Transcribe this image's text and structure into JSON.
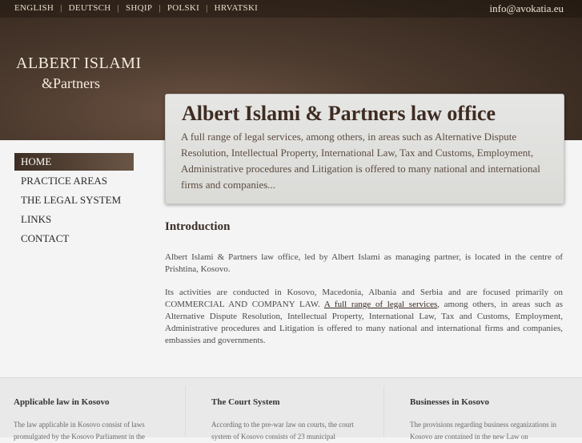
{
  "languages": [
    "ENGLISH",
    "DEUTSCH",
    "SHQIP",
    "POLSKI",
    "HRVATSKI"
  ],
  "email": "info@avokatia.eu",
  "logo": {
    "line1": "ALBERT ISLAMI",
    "line2": "&Partners"
  },
  "hero": {
    "title": "Albert Islami & Partners law office",
    "text": "A full range of legal services, among others, in areas such as Alternative Dispute Resolution, Intellectual Property, International Law, Tax and Customs, Employment, Administrative procedures and Litigation is offered to many national and international firms and companies..."
  },
  "nav": [
    "HOME",
    "PRACTICE AREAS",
    "THE LEGAL SYSTEM",
    "LINKS",
    "CONTACT"
  ],
  "main": {
    "heading": "Introduction",
    "p1": "Albert Islami & Partners law office, led by Albert Islami as managing partner, is located in the centre of Prishtina, Kosovo.",
    "p2_before": "Its activities are conducted in Kosovo, Macedonia, Albania and Serbia and are focused primarily on COMMERCIAL AND COMPANY LAW. ",
    "p2_link": "A full range of legal services",
    "p2_after": ", among others, in areas such as Alternative Dispute Resolution, Intellectual Property, International Law, Tax and Customs, Employment, Administrative procedures and Litigation is offered to many national and international firms and companies, embassies and governments."
  },
  "footer": [
    {
      "title": "Applicable law in Kosovo",
      "text": "The law applicable in Kosovo consist of laws promulgated by the Kosovo Parliament in the"
    },
    {
      "title": "The Court System",
      "text": "According to the pre-war law on courts, the court system of Kosovo consists of 23 municipal"
    },
    {
      "title": "Businesses in Kosovo",
      "text": "The provisions regarding business organizations in Kosovo are contained in the new Law on"
    }
  ]
}
